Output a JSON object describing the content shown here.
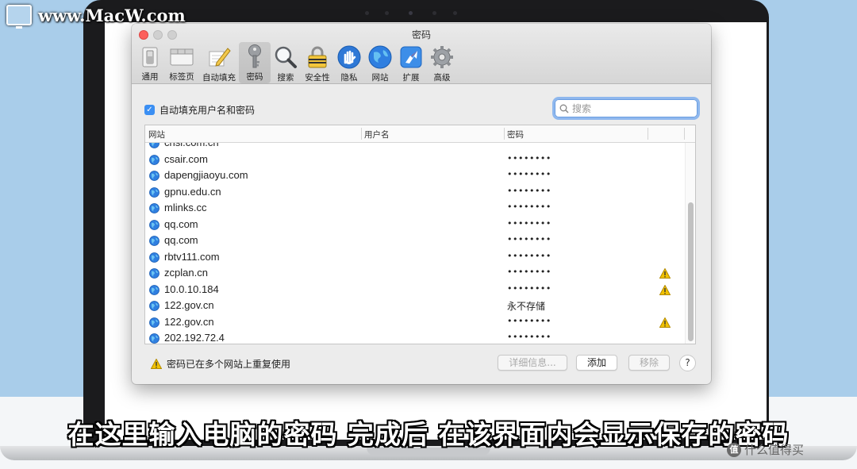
{
  "watermark": {
    "text": "www.MacW.com"
  },
  "window": {
    "title": "密码"
  },
  "toolbar": {
    "items": [
      {
        "label": "通用"
      },
      {
        "label": "标签页"
      },
      {
        "label": "自动填充"
      },
      {
        "label": "密码"
      },
      {
        "label": "搜索"
      },
      {
        "label": "安全性"
      },
      {
        "label": "隐私"
      },
      {
        "label": "网站"
      },
      {
        "label": "扩展"
      },
      {
        "label": "高级"
      }
    ],
    "active": "密码"
  },
  "autofill": {
    "label": "自动填充用户名和密码",
    "checked": true
  },
  "search": {
    "placeholder": "搜索"
  },
  "table": {
    "headers": {
      "website": "网站",
      "username": "用户名",
      "password": "密码"
    },
    "rows": [
      {
        "site": "chsi.com.cn",
        "password": "••••••••",
        "warning": false
      },
      {
        "site": "csair.com",
        "password": "••••••••",
        "warning": false
      },
      {
        "site": "dapengjiaoyu.com",
        "password": "••••••••",
        "warning": false
      },
      {
        "site": "gpnu.edu.cn",
        "password": "••••••••",
        "warning": false
      },
      {
        "site": "mlinks.cc",
        "password": "••••••••",
        "warning": false
      },
      {
        "site": "qq.com",
        "password": "••••••••",
        "warning": false
      },
      {
        "site": "qq.com",
        "password": "••••••••",
        "warning": false
      },
      {
        "site": "rbtv111.com",
        "password": "••••••••",
        "warning": false
      },
      {
        "site": "zcplan.cn",
        "password": "••••••••",
        "warning": true
      },
      {
        "site": "10.0.10.184",
        "password": "••••••••",
        "warning": true
      },
      {
        "site": "122.gov.cn",
        "password": "永不存储",
        "warning": false
      },
      {
        "site": "122.gov.cn",
        "password": "••••••••",
        "warning": true
      },
      {
        "site": "202.192.72.4",
        "password": "••••••••",
        "warning": false
      }
    ]
  },
  "footer": {
    "reuse_note": "密码已在多个网站上重复使用",
    "details_button": "详细信息...",
    "add_button": "添加",
    "remove_button": "移除",
    "help_button": "?"
  },
  "subtitle": "在这里输入电脑的密码 完成后 在该界面内会显示保存的密码",
  "corner_badge": {
    "icon": "值",
    "text": "什么值得买"
  },
  "colors": {
    "accent": "#3b8ff3",
    "close": "#fc605c",
    "warning": "#f2c200",
    "background": "#a9cdea"
  }
}
